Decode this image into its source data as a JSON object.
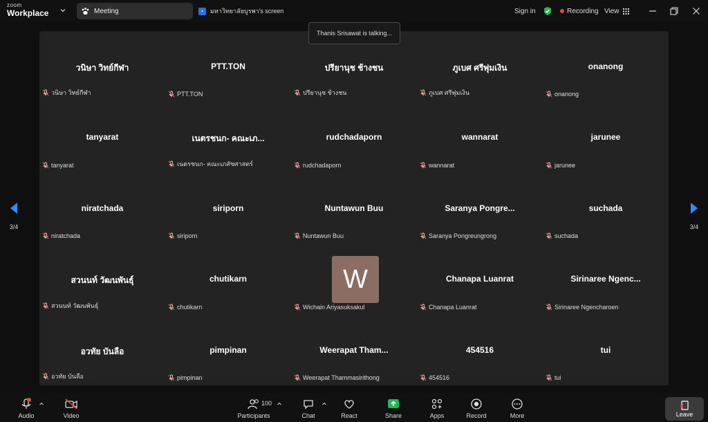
{
  "app": {
    "logo_top": "zoom",
    "logo_bottom": "Workplace"
  },
  "tabs": {
    "meeting": "Meeting",
    "screen": "มหาวิทยาลัยบูรพา's screen"
  },
  "topright": {
    "signin": "Sign in",
    "recording": "Recording",
    "view": "View"
  },
  "toast": "Thanis Srisawat is talking...",
  "pager": {
    "left": "3/4",
    "right": "3/4"
  },
  "tiles": [
    {
      "name": "วนิษา วิทย์กีฬา",
      "label": "วนิษา วิทย์กีฬา"
    },
    {
      "name": "PTT.TON",
      "label": "PTT.TON"
    },
    {
      "name": "ปรียานุช ช้างชน",
      "label": "ปรียานุช ช้างชน"
    },
    {
      "name": "ภูเบศ ศรีพุ่มเงิน",
      "label": "ภูเบศ ศรีพุ่มเงิน"
    },
    {
      "name": "onanong",
      "label": "onanong"
    },
    {
      "name": "tanyarat",
      "label": "tanyarat"
    },
    {
      "name": "เนตรชนก- คณะเภ...",
      "label": "เนตรชนก- คณะเภสัชศาสตร์"
    },
    {
      "name": "rudchadaporn",
      "label": "rudchadaporn"
    },
    {
      "name": "wannarat",
      "label": "wannarat"
    },
    {
      "name": "jarunee",
      "label": "jarunee"
    },
    {
      "name": "niratchada",
      "label": "niratchada"
    },
    {
      "name": "siriporn",
      "label": "siriporn"
    },
    {
      "name": "Nuntawun  Buu",
      "label": "Nuntawun  Buu"
    },
    {
      "name": "Saranya  Pongre...",
      "label": "Saranya Pongreungrong"
    },
    {
      "name": "suchada",
      "label": "suchada"
    },
    {
      "name": "สวนนท์ วัฒนพันธุ์",
      "label": "สวนนท์ วัฒนพันธุ์"
    },
    {
      "name": "chutikarn",
      "label": "chutikarn"
    },
    {
      "name": "",
      "label": "Wichain Ariyasuksakul",
      "avatar": "W"
    },
    {
      "name": "Chanapa Luanrat",
      "label": "Chanapa Luanrat"
    },
    {
      "name": "Sirinaree  Ngenc...",
      "label": "Sirinaree Ngencharoen"
    },
    {
      "name": "อวทัย บันลือ",
      "label": "อวทัย บันลือ"
    },
    {
      "name": "pimpinan",
      "label": "pimpinan"
    },
    {
      "name": "Weerapat  Tham...",
      "label": "Weerapat Thammasirithong"
    },
    {
      "name": "454516",
      "label": "454516"
    },
    {
      "name": "tui",
      "label": "tui"
    }
  ],
  "toolbar": {
    "audio": "Audio",
    "video": "Video",
    "participants": "Participants",
    "participants_count": "100",
    "chat": "Chat",
    "react": "React",
    "share": "Share",
    "apps": "Apps",
    "record": "Record",
    "more": "More",
    "leave": "Leave"
  },
  "colors": {
    "accent_green": "#1db954",
    "recording_red": "#e8454b",
    "pager_blue": "#2d8cff",
    "avatar_bg": "#8c6d61"
  }
}
